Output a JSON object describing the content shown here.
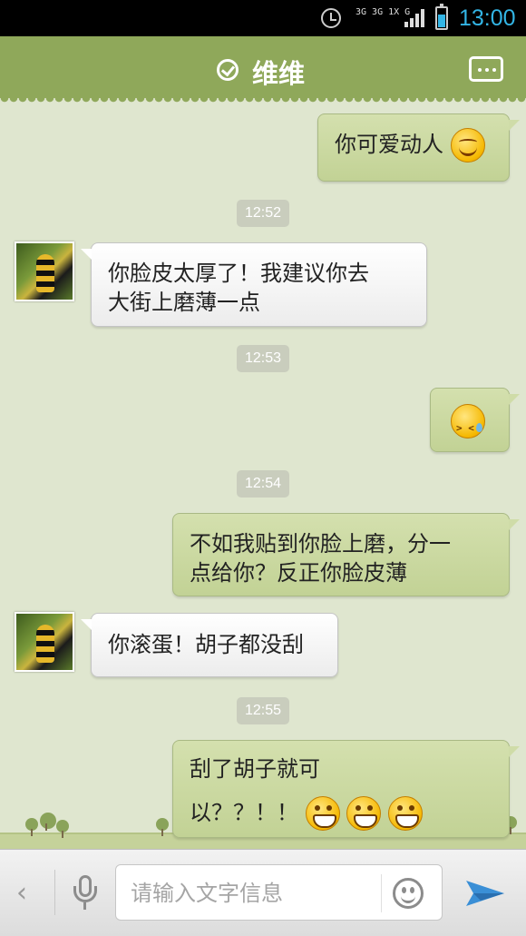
{
  "status_bar": {
    "time": "13:00",
    "network_text": "3G 3G 1X G",
    "icons": [
      "alarm-clock-icon",
      "signal-icon",
      "battery-icon"
    ],
    "time_color": "#33b5e5"
  },
  "header": {
    "title": "维维",
    "left_icon": "verified-check-icon",
    "right_icon": "more-menu-icon",
    "background_color": "#8fa85a"
  },
  "messages": [
    {
      "direction": "outgoing",
      "text": "你可爱动人",
      "emoji": "smile"
    },
    {
      "type": "timestamp",
      "text": "12:52"
    },
    {
      "direction": "incoming",
      "line1": "你脸皮太厚了！我建议你去",
      "line2": "大街上磨薄一点"
    },
    {
      "type": "timestamp",
      "text": "12:53"
    },
    {
      "direction": "outgoing",
      "emoji_only": "sweat"
    },
    {
      "type": "timestamp",
      "text": "12:54"
    },
    {
      "direction": "outgoing",
      "line1": "不如我贴到你脸上磨，分一",
      "line2": "点给你？反正你脸皮薄"
    },
    {
      "direction": "incoming",
      "text": "你滚蛋！胡子都没刮"
    },
    {
      "type": "timestamp",
      "text": "12:55"
    },
    {
      "direction": "outgoing",
      "line1": "刮了胡子就可",
      "line2": "以？？！！",
      "emoji": "grin",
      "emoji_count": 3
    }
  ],
  "input_bar": {
    "placeholder": "请输入文字信息",
    "value": "",
    "icons": [
      "back-arrow-icon",
      "microphone-icon",
      "emoji-icon",
      "send-icon"
    ],
    "send_color": "#3a8fd6"
  },
  "colors": {
    "chat_background": "#dfe6cf",
    "outgoing_bubble": "#c8d79c",
    "incoming_bubble": "#f4f4f4"
  }
}
